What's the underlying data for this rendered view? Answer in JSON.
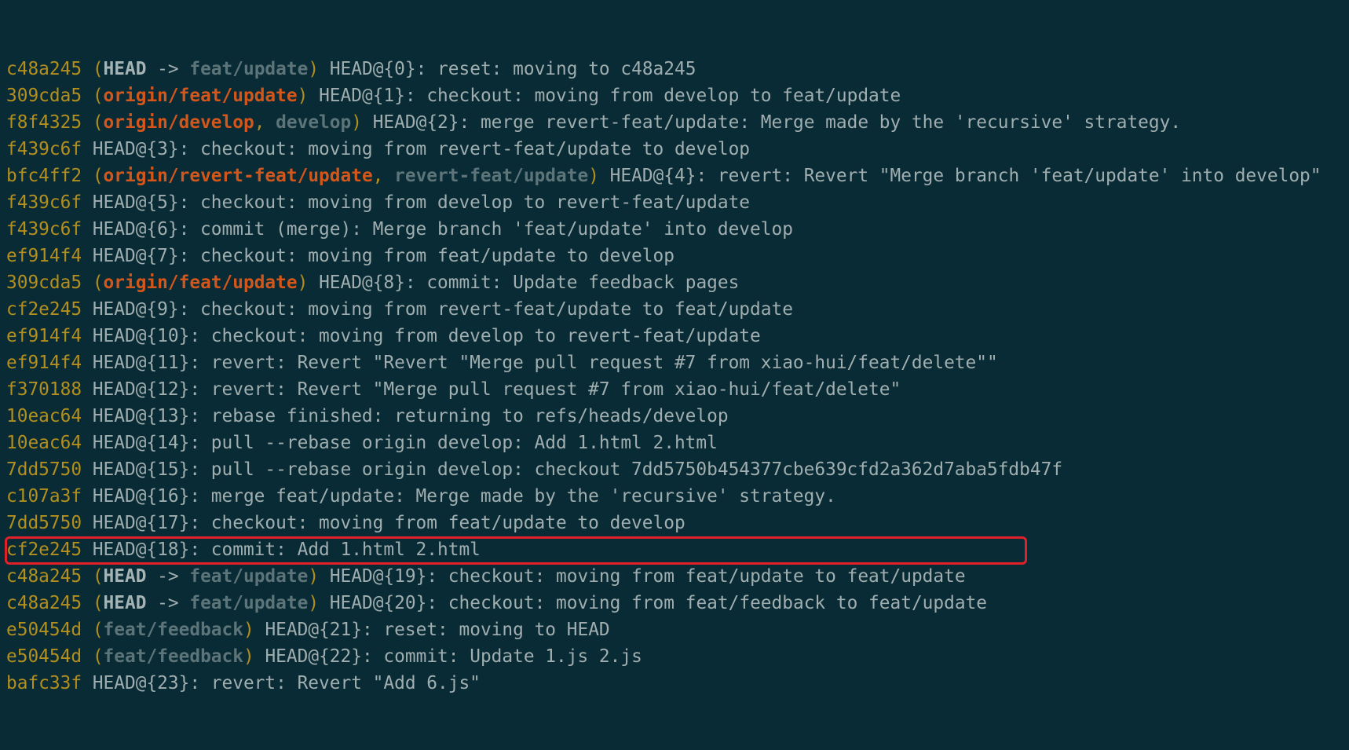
{
  "colors": {
    "background": "#082b35",
    "hash": "#b28f1e",
    "remote_branch": "#d3561b",
    "local_branch": "#5d7479",
    "head": "#a6b3b4",
    "text": "#a1aeaf",
    "highlight_border": "#e0202a"
  },
  "highlighted_line_index": 20,
  "lines": [
    {
      "hash": "c48a245",
      "refs": [
        {
          "type": "head",
          "text": "HEAD"
        },
        {
          "type": "local",
          "text": "feat/update"
        }
      ],
      "message": "HEAD@{0}: reset: moving to c48a245"
    },
    {
      "hash": "309cda5",
      "refs": [
        {
          "type": "remote",
          "text": "origin/feat/update"
        }
      ],
      "message": "HEAD@{1}: checkout: moving from develop to feat/update"
    },
    {
      "hash": "f8f4325",
      "refs": [
        {
          "type": "remote",
          "text": "origin/develop"
        },
        {
          "type": "local",
          "text": "develop"
        }
      ],
      "message": "HEAD@{2}: merge revert-feat/update: Merge made by the 'recursive' strategy."
    },
    {
      "hash": "f439c6f",
      "refs": [],
      "message": "HEAD@{3}: checkout: moving from revert-feat/update to develop"
    },
    {
      "hash": "bfc4ff2",
      "refs": [
        {
          "type": "remote",
          "text": "origin/revert-feat/update"
        },
        {
          "type": "local",
          "text": "revert-feat/update"
        }
      ],
      "message": "HEAD@{4}: revert: Revert \"Merge branch 'feat/update' into develop\""
    },
    {
      "hash": "f439c6f",
      "refs": [],
      "message": "HEAD@{5}: checkout: moving from develop to revert-feat/update"
    },
    {
      "hash": "f439c6f",
      "refs": [],
      "message": "HEAD@{6}: commit (merge): Merge branch 'feat/update' into develop"
    },
    {
      "hash": "ef914f4",
      "refs": [],
      "message": "HEAD@{7}: checkout: moving from feat/update to develop"
    },
    {
      "hash": "309cda5",
      "refs": [
        {
          "type": "remote",
          "text": "origin/feat/update"
        }
      ],
      "message": "HEAD@{8}: commit: Update feedback pages"
    },
    {
      "hash": "cf2e245",
      "refs": [],
      "message": "HEAD@{9}: checkout: moving from revert-feat/update to feat/update"
    },
    {
      "hash": "ef914f4",
      "refs": [],
      "message": "HEAD@{10}: checkout: moving from develop to revert-feat/update"
    },
    {
      "hash": "ef914f4",
      "refs": [],
      "message": "HEAD@{11}: revert: Revert \"Revert \"Merge pull request #7 from xiao-hui/feat/delete\"\""
    },
    {
      "hash": "f370188",
      "refs": [],
      "message": "HEAD@{12}: revert: Revert \"Merge pull request #7 from xiao-hui/feat/delete\""
    },
    {
      "hash": "10eac64",
      "refs": [],
      "message": "HEAD@{13}: rebase finished: returning to refs/heads/develop"
    },
    {
      "hash": "10eac64",
      "refs": [],
      "message": "HEAD@{14}: pull --rebase origin develop: Add 1.html 2.html"
    },
    {
      "hash": "7dd5750",
      "refs": [],
      "message": "HEAD@{15}: pull --rebase origin develop: checkout 7dd5750b454377cbe639cfd2a362d7aba5fdb47f"
    },
    {
      "hash": "c107a3f",
      "refs": [],
      "message": "HEAD@{16}: merge feat/update: Merge made by the 'recursive' strategy."
    },
    {
      "hash": "7dd5750",
      "refs": [],
      "message": "HEAD@{17}: checkout: moving from feat/update to develop"
    },
    {
      "hash": "cf2e245",
      "refs": [],
      "message": "HEAD@{18}: commit: Add 1.html 2.html"
    },
    {
      "hash": "c48a245",
      "refs": [
        {
          "type": "head",
          "text": "HEAD"
        },
        {
          "type": "local",
          "text": "feat/update"
        }
      ],
      "message": "HEAD@{19}: checkout: moving from feat/update to feat/update"
    },
    {
      "hash": "c48a245",
      "refs": [
        {
          "type": "head",
          "text": "HEAD"
        },
        {
          "type": "local",
          "text": "feat/update"
        }
      ],
      "message": "HEAD@{20}: checkout: moving from feat/feedback to feat/update"
    },
    {
      "hash": "e50454d",
      "refs": [
        {
          "type": "local",
          "text": "feat/feedback"
        }
      ],
      "message": "HEAD@{21}: reset: moving to HEAD"
    },
    {
      "hash": "e50454d",
      "refs": [
        {
          "type": "local",
          "text": "feat/feedback"
        }
      ],
      "message": "HEAD@{22}: commit: Update 1.js 2.js"
    },
    {
      "hash": "bafc33f",
      "refs": [],
      "message": "HEAD@{23}: revert: Revert \"Add 6.js\""
    }
  ]
}
